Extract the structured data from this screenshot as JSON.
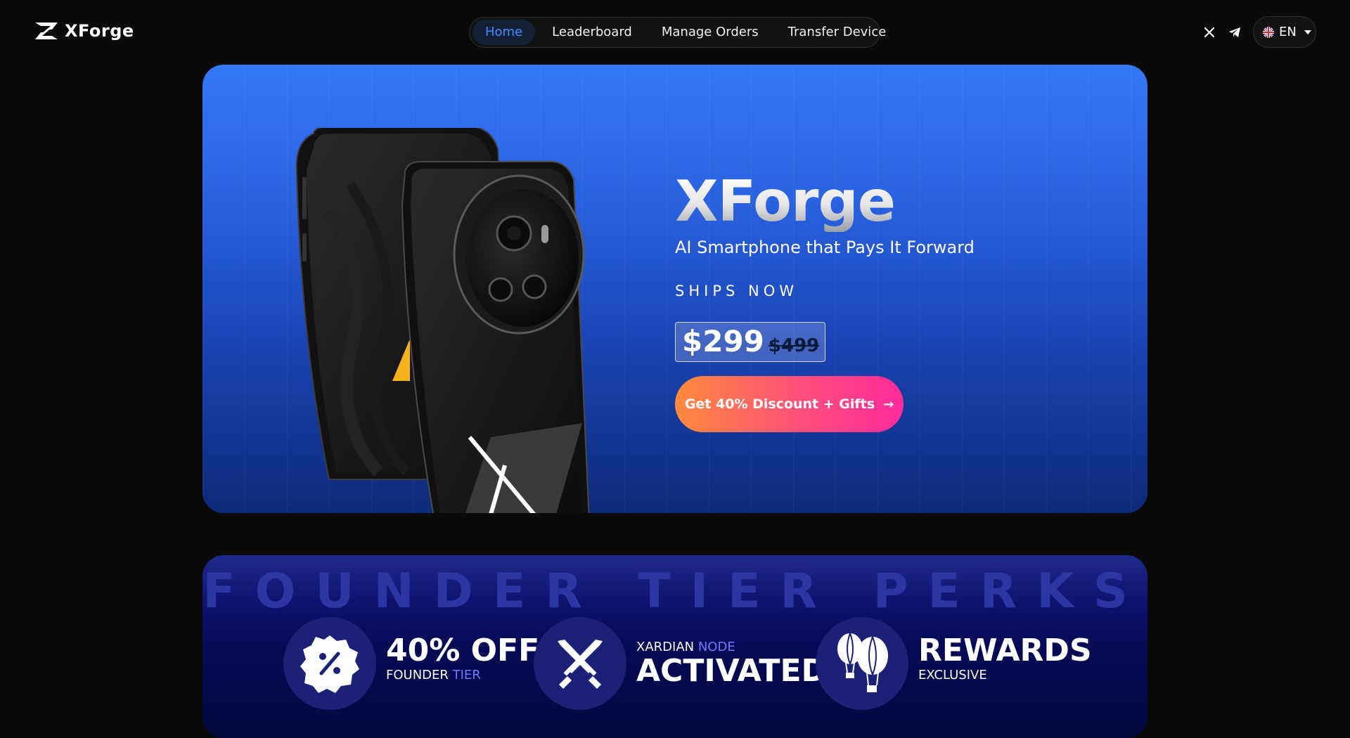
{
  "header": {
    "brand": "XForge",
    "nav": [
      {
        "label": "Home",
        "active": true
      },
      {
        "label": "Leaderboard",
        "active": false
      },
      {
        "label": "Manage Orders",
        "active": false
      },
      {
        "label": "Transfer Device",
        "active": false
      }
    ],
    "social": [
      "x-icon",
      "telegram-icon"
    ],
    "language": {
      "label": "EN",
      "flag": "uk-flag-icon"
    }
  },
  "hero": {
    "title": "XForge",
    "subtitle": "AI Smartphone that Pays It Forward",
    "ships": "SHIPS NOW",
    "price_now": "$299",
    "price_old": "$499",
    "cta_label": "Get 40% Discount + Gifts",
    "cta_arrow": "→"
  },
  "perks": {
    "title": "FOUNDER TIER PERKS",
    "items": [
      {
        "icon": "percent-badge-icon",
        "big": "40% OFF",
        "small_a": "FOUNDER ",
        "small_b": "TIER"
      },
      {
        "icon": "crossed-swords-icon",
        "pre_a": "XARDIAN ",
        "pre_b": "NODE",
        "big": "ACTIVATED"
      },
      {
        "icon": "hot-air-balloons-icon",
        "big": "REWARDS",
        "small_a": "EXCLUSIVE",
        "small_b": ""
      }
    ]
  },
  "colors": {
    "accent": "#3d8bff",
    "hero_top": "#3478f7",
    "hero_bottom": "#0c2a78",
    "cta_start": "#ff8a3d",
    "cta_end": "#ff2a9d",
    "perks_bg": "#050a55"
  }
}
